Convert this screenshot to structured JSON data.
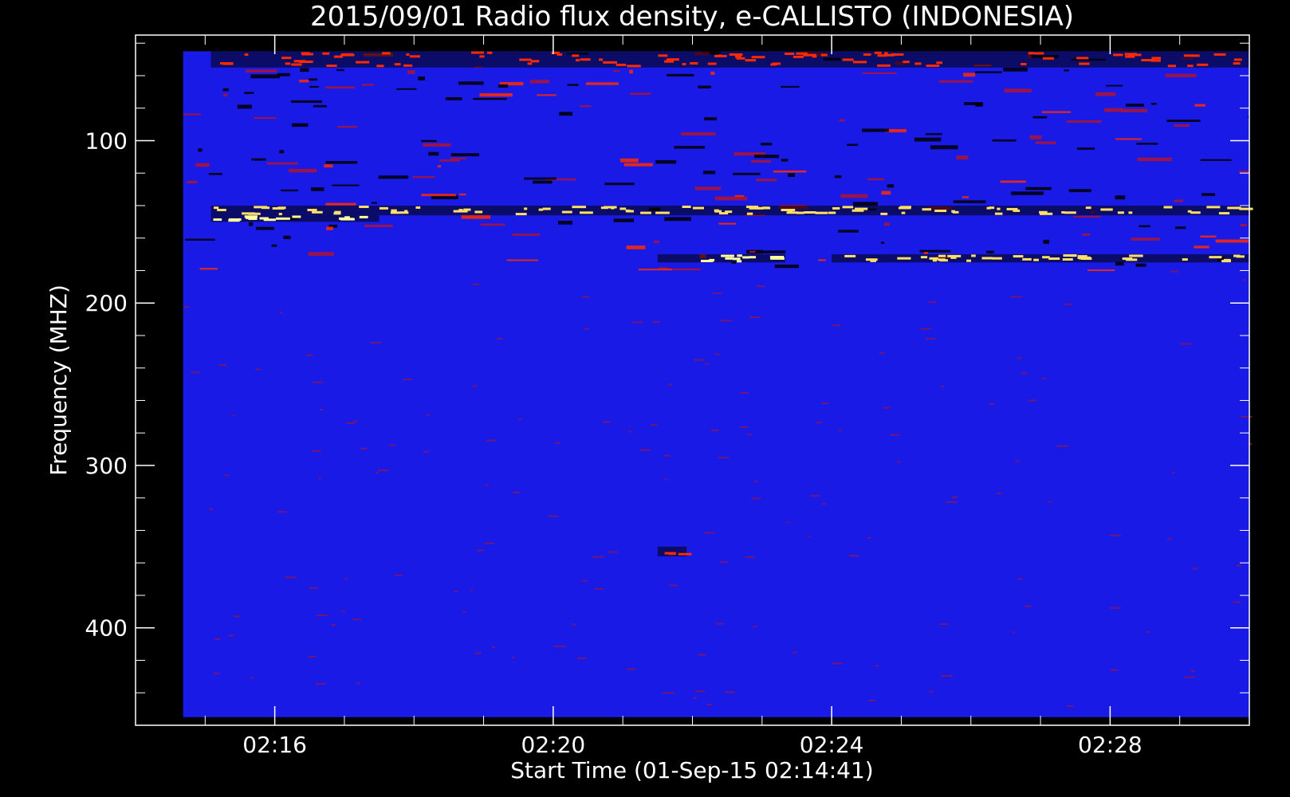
{
  "chart_data": {
    "type": "heatmap",
    "title": "2015/09/01  Radio flux density, e-CALLISTO (INDONESIA)",
    "xlabel": "Start Time (01-Sep-15 02:14:41)",
    "ylabel": "Frequency (MHZ)",
    "x_range": [
      "02:14:41",
      "02:30:00"
    ],
    "x_axis_range": [
      "02:14:00",
      "02:30:00"
    ],
    "x_ticks": [
      "02:16",
      "02:20",
      "02:24",
      "02:28"
    ],
    "y_range": [
      45,
      455
    ],
    "y_axis_range": [
      35,
      460
    ],
    "y_reversed": true,
    "y_ticks": [
      100,
      200,
      300,
      400
    ],
    "colorscale": [
      "#000000",
      "#1a1ae6",
      "#b0142e",
      "#ff2a00",
      "#ffe066",
      "#ffffa0"
    ],
    "background_color": "#1a1ae6",
    "bursts": [
      {
        "freq_range": [
          140,
          146
        ],
        "time_range": [
          "02:15:05",
          "02:30:00"
        ],
        "intensity": "high"
      },
      {
        "freq_range": [
          146,
          150
        ],
        "time_range": [
          "02:15:05",
          "02:17:30"
        ],
        "intensity": "very-high"
      },
      {
        "freq_range": [
          170,
          175
        ],
        "time_range": [
          "02:21:30",
          "02:23:20"
        ],
        "intensity": "very-high"
      },
      {
        "freq_range": [
          170,
          175
        ],
        "time_range": [
          "02:24:00",
          "02:30:00"
        ],
        "intensity": "high"
      },
      {
        "freq_range": [
          45,
          55
        ],
        "time_range": [
          "02:15:05",
          "02:30:00"
        ],
        "intensity": "medium"
      },
      {
        "freq_range": [
          350,
          356
        ],
        "time_range": [
          "02:21:30",
          "02:21:55"
        ],
        "intensity": "medium"
      }
    ]
  }
}
